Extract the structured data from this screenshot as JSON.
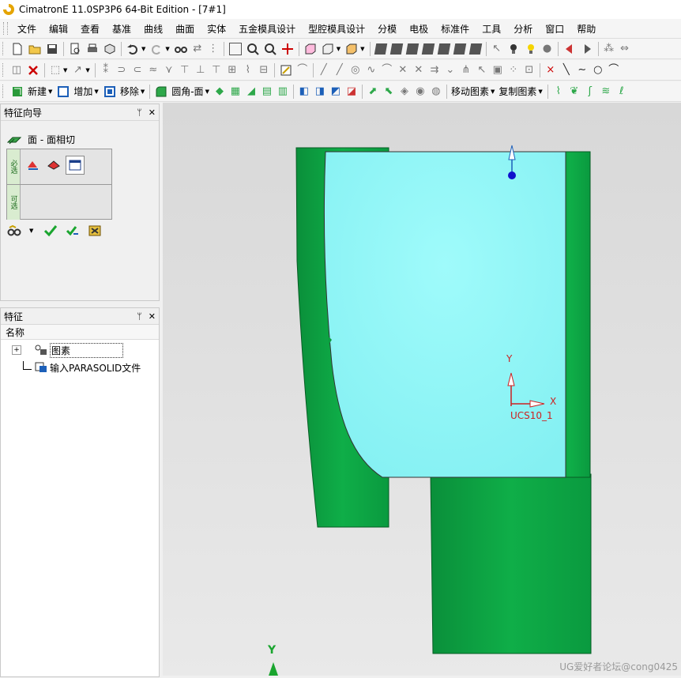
{
  "window": {
    "title": "CimatronE 11.0SP3P6 64-Bit Edition - [7#1]"
  },
  "menu": [
    "文件",
    "编辑",
    "查看",
    "基准",
    "曲线",
    "曲面",
    "实体",
    "五金模具设计",
    "型腔模具设计",
    "分模",
    "电极",
    "标准件",
    "工具",
    "分析",
    "窗口",
    "帮助"
  ],
  "toolbar3": {
    "new_label": "新建",
    "add_label": "增加",
    "move_label": "移除",
    "fillet_label": "圆角-面",
    "move_entity_label": "移动图素",
    "copy_entity_label": "复制图素"
  },
  "feature_wizard": {
    "title": "特征向导",
    "pin": "ᛘ",
    "close": "✕",
    "operation": "面 - 面相切",
    "row1_tag": "必选",
    "row2_tag": "可选"
  },
  "feature_tree": {
    "title": "特征",
    "column": "名称",
    "items": [
      {
        "label": "图素",
        "expander": "+"
      },
      {
        "label": "输入PARASOLID文件"
      }
    ]
  },
  "viewport": {
    "ucs_label": "UCS10_1",
    "axis_x": "X",
    "axis_y": "Y",
    "axis_y_bottom": "Y",
    "watermark": "UG爱好者论坛@cong0425",
    "colors": {
      "solid": "#0b9e3f",
      "selected_face": "#8ff6f6",
      "background": "#e4e4e4"
    }
  }
}
